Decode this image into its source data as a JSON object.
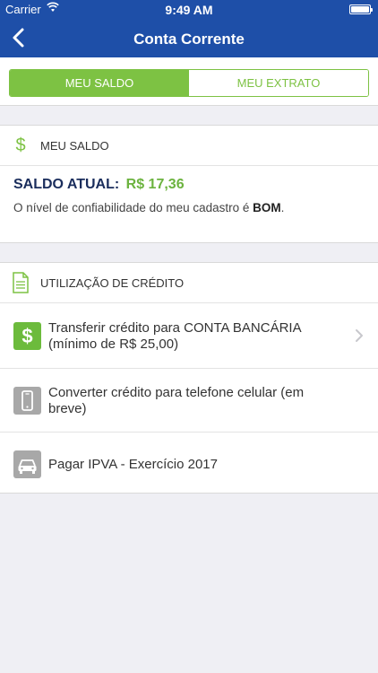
{
  "status": {
    "carrier": "Carrier",
    "time": "9:49 AM"
  },
  "nav": {
    "title": "Conta Corrente"
  },
  "tabs": [
    {
      "label": "MEU SALDO",
      "active": true
    },
    {
      "label": "MEU EXTRATO",
      "active": false
    }
  ],
  "saldo_section": {
    "title": "MEU SALDO",
    "icon": "dollar-icon",
    "balance_label": "SALDO ATUAL:",
    "balance_value": "R$ 17,36",
    "trust_text_prefix": "O nível de confiabilidade do meu cadastro é ",
    "trust_level": "BOM",
    "trust_text_suffix": "."
  },
  "credito_section": {
    "title": "UTILIZAÇÃO DE CRÉDITO",
    "icon": "document-icon",
    "items": [
      {
        "label": "Transferir crédito para CONTA BANCÁRIA (mínimo de R$ 25,00)",
        "icon": "dollar-icon",
        "enabled": true
      },
      {
        "label": "Converter crédito para telefone celular (em breve)",
        "icon": "phone-icon",
        "enabled": false
      },
      {
        "label": "Pagar IPVA - Exercício 2017",
        "icon": "car-icon",
        "enabled": false
      }
    ]
  },
  "colors": {
    "header": "#1e4fa8",
    "accent_green": "#7dc243",
    "disabled_gray": "#a8a8a8",
    "background": "#efeff4"
  }
}
